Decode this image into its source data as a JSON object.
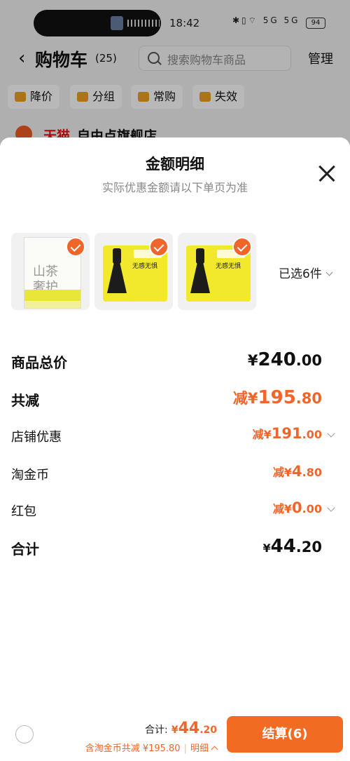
{
  "status_bar": {
    "time": "18:42",
    "battery": "94",
    "signal_icons": "✱▯⌔ 5G 5G"
  },
  "cart": {
    "title": "购物车",
    "count": "(25)",
    "search_placeholder": "搜索购物车商品",
    "manage_label": "管理",
    "filters": [
      "降价",
      "分组",
      "常购",
      "失效"
    ],
    "store_brand": "天猫",
    "store_name": "自由点旗舰店"
  },
  "sheet": {
    "title": "金额明细",
    "subtitle": "实际优惠金额请以下单页为准",
    "products": [
      {
        "name_text": "山茶\n奢护",
        "checked": true
      },
      {
        "name_text": "无感无惧",
        "checked": true
      },
      {
        "name_text": "无感无惧",
        "checked": true
      }
    ],
    "selected_label": "已选6件",
    "rows": {
      "subtotal": {
        "label": "商品总价",
        "currency": "¥",
        "integer": "240",
        "decimal": ".00"
      },
      "total_discount": {
        "label": "共减",
        "prefix": "减¥",
        "integer": "195",
        "decimal": ".80"
      },
      "store_discount": {
        "label": "店铺优惠",
        "prefix": "减¥",
        "integer": "191",
        "decimal": ".00"
      },
      "taojinbi": {
        "label": "淘金币",
        "prefix": "减¥",
        "integer": "4",
        "decimal": ".80"
      },
      "red_packet": {
        "label": "红包",
        "prefix": "减¥",
        "integer": "0",
        "decimal": ".00"
      },
      "grand_total": {
        "label": "合计",
        "currency": "¥",
        "integer": "44",
        "decimal": ".20"
      }
    }
  },
  "bottom_bar": {
    "total_label": "合计:",
    "total_currency": "¥",
    "total_integer": "44",
    "total_decimal": ".20",
    "sub_text": "含淘金币共减 ¥195.80",
    "detail_label": "明细",
    "checkout_label": "结算(6)"
  },
  "colors": {
    "accent": "#f26b22",
    "discount": "#f0662a",
    "tmall_red": "#f01010"
  }
}
